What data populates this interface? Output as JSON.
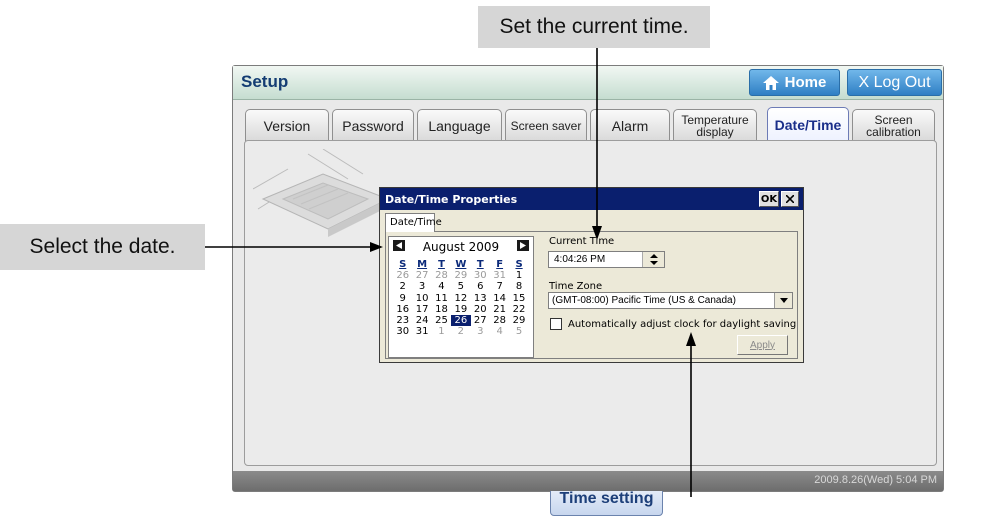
{
  "callouts": {
    "time": "Set the current time.",
    "date": "Select the date."
  },
  "app": {
    "title": "Setup",
    "home_label": "Home",
    "logout_label": "X Log Out",
    "status_time": "2009.8.26(Wed)  5:04 PM",
    "time_setting_label": "Time setting"
  },
  "tabs": [
    {
      "label": "Version"
    },
    {
      "label": "Password"
    },
    {
      "label": "Language"
    },
    {
      "label": "Screen saver"
    },
    {
      "label": "Alarm"
    },
    {
      "label": "Temperature display"
    },
    {
      "label": "Date/Time",
      "active": true
    },
    {
      "label": "Screen calibration"
    }
  ],
  "dialog": {
    "title": "Date/Time Properties",
    "ok_label": "OK",
    "tab_label": "Date/Time",
    "calendar": {
      "month": "August 2009",
      "weekdays": [
        "S",
        "M",
        "T",
        "W",
        "T",
        "F",
        "S"
      ],
      "weeks": [
        [
          "26",
          "27",
          "28",
          "29",
          "30",
          "31",
          "1"
        ],
        [
          "2",
          "3",
          "4",
          "5",
          "6",
          "7",
          "8"
        ],
        [
          "9",
          "10",
          "11",
          "12",
          "13",
          "14",
          "15"
        ],
        [
          "16",
          "17",
          "18",
          "19",
          "20",
          "21",
          "22"
        ],
        [
          "23",
          "24",
          "25",
          "26",
          "27",
          "28",
          "29"
        ],
        [
          "30",
          "31",
          "1",
          "2",
          "3",
          "4",
          "5"
        ]
      ],
      "selected": "26"
    },
    "current_time_label": "Current Time",
    "current_time_value": "4:04:26 PM",
    "time_zone_label": "Time Zone",
    "time_zone_value": "(GMT-08:00) Pacific Time (US & Canada)",
    "dst_label": "Automatically adjust clock for daylight saving",
    "apply_label": "Apply"
  },
  "colors": {
    "title_text": "#143c73",
    "top_button": "#2f7fc4",
    "dialog_titlebar": "#0a1f6e",
    "active_tab_text": "#1a2f8a"
  }
}
